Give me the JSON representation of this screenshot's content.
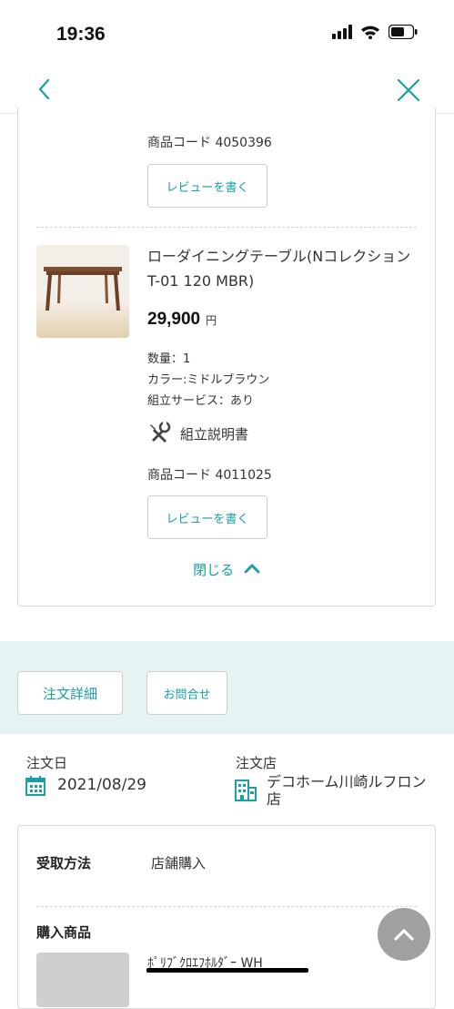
{
  "status_bar": {
    "time": "19:36"
  },
  "nav": {
    "back": "back",
    "close": "close"
  },
  "order_items": [
    {
      "code_label": "商品コード 4050396",
      "review_label": "レビューを書く"
    },
    {
      "name": "ローダイニングテーブル(Nコレクション T-01 120 MBR)",
      "price": "29,900",
      "price_unit": "円",
      "quantity": "数量：1",
      "color": "カラー:ミドルブラウン",
      "assembly": "組立サービス：あり",
      "manual_label": "組立説明書",
      "code_label": "商品コード 4011025",
      "review_label": "レビューを書く"
    }
  ],
  "collapse_label": "閉じる",
  "actions": {
    "order_detail": "注文詳細",
    "inquiry": "お問合せ"
  },
  "order_info": {
    "date_label": "注文日",
    "date": "2021/08/29",
    "shop_label": "注文店",
    "shop": "デコホーム川崎ルフロン店"
  },
  "receipt": {
    "method_label": "受取方法",
    "method": "店舗購入",
    "items_label": "購入商品",
    "first_item": "ﾎﾟﾘﾌﾞｸﾛｴﾌﾎﾙﾀﾞｰ WH"
  },
  "colors": {
    "accent": "#1aa0a3",
    "band": "#e6f3f3"
  }
}
